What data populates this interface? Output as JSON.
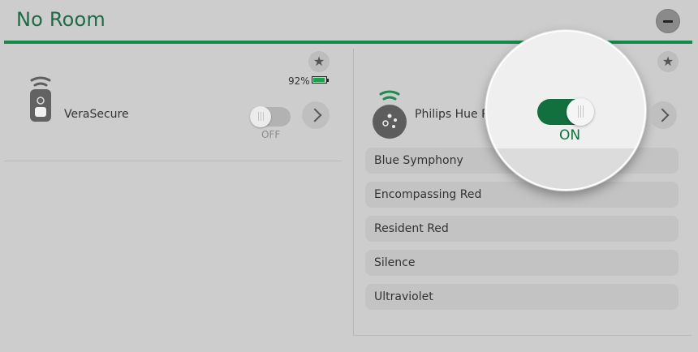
{
  "room": {
    "title": "No Room",
    "collapse_icon": "minus-icon"
  },
  "devices": {
    "left": {
      "name": "VeraSecure",
      "icon": "remote-device-icon",
      "battery_percent_label": "92%",
      "battery_level": 0.92,
      "battery_color": "#16a34a",
      "favorite_icon": "star-icon",
      "switch_state": "OFF",
      "details_icon": "chevron-right-icon"
    },
    "right": {
      "name": "Philips Hue Plu",
      "icon": "hue-bridge-icon",
      "signal_color": "#1e8a4f",
      "favorite_icon": "star-icon",
      "switch_state": "ON",
      "switch_color": "#12703f",
      "details_icon": "chevron-right-icon",
      "scenes": [
        {
          "label": "Blue Symphony"
        },
        {
          "label": "Encompassing Red"
        },
        {
          "label": "Resident Red"
        },
        {
          "label": "Silence"
        },
        {
          "label": "Ultraviolet"
        }
      ]
    }
  },
  "colors": {
    "accent": "#168847",
    "background": "#cdcdcd"
  }
}
